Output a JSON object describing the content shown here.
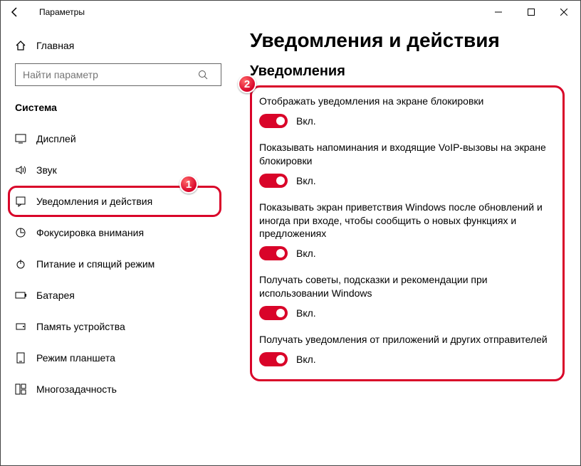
{
  "window": {
    "title": "Параметры"
  },
  "sidebar": {
    "home": "Главная",
    "search_placeholder": "Найти параметр",
    "group": "Система",
    "items": [
      {
        "icon": "display-icon",
        "label": "Дисплей"
      },
      {
        "icon": "sound-icon",
        "label": "Звук"
      },
      {
        "icon": "notify-icon",
        "label": "Уведомления и действия",
        "selected": true
      },
      {
        "icon": "focus-icon",
        "label": "Фокусировка внимания"
      },
      {
        "icon": "power-icon",
        "label": "Питание и спящий режим"
      },
      {
        "icon": "battery-icon",
        "label": "Батарея"
      },
      {
        "icon": "storage-icon",
        "label": "Память устройства"
      },
      {
        "icon": "tablet-icon",
        "label": "Режим планшета"
      },
      {
        "icon": "multitask-icon",
        "label": "Многозадачность"
      }
    ]
  },
  "main": {
    "heading": "Уведомления и действия",
    "subheading": "Уведомления",
    "toggle_on": "Вкл.",
    "settings": [
      "Отображать уведомления на экране блокировки",
      "Показывать напоминания и входящие VoIP-вызовы на экране блокировки",
      "Показывать экран приветствия Windows после обновлений и иногда при входе, чтобы сообщить о новых функциях и предложениях",
      "Получать советы, подсказки и рекомендации при использовании Windows",
      "Получать уведомления от приложений и других отправителей"
    ]
  },
  "callouts": {
    "one": "1",
    "two": "2"
  }
}
